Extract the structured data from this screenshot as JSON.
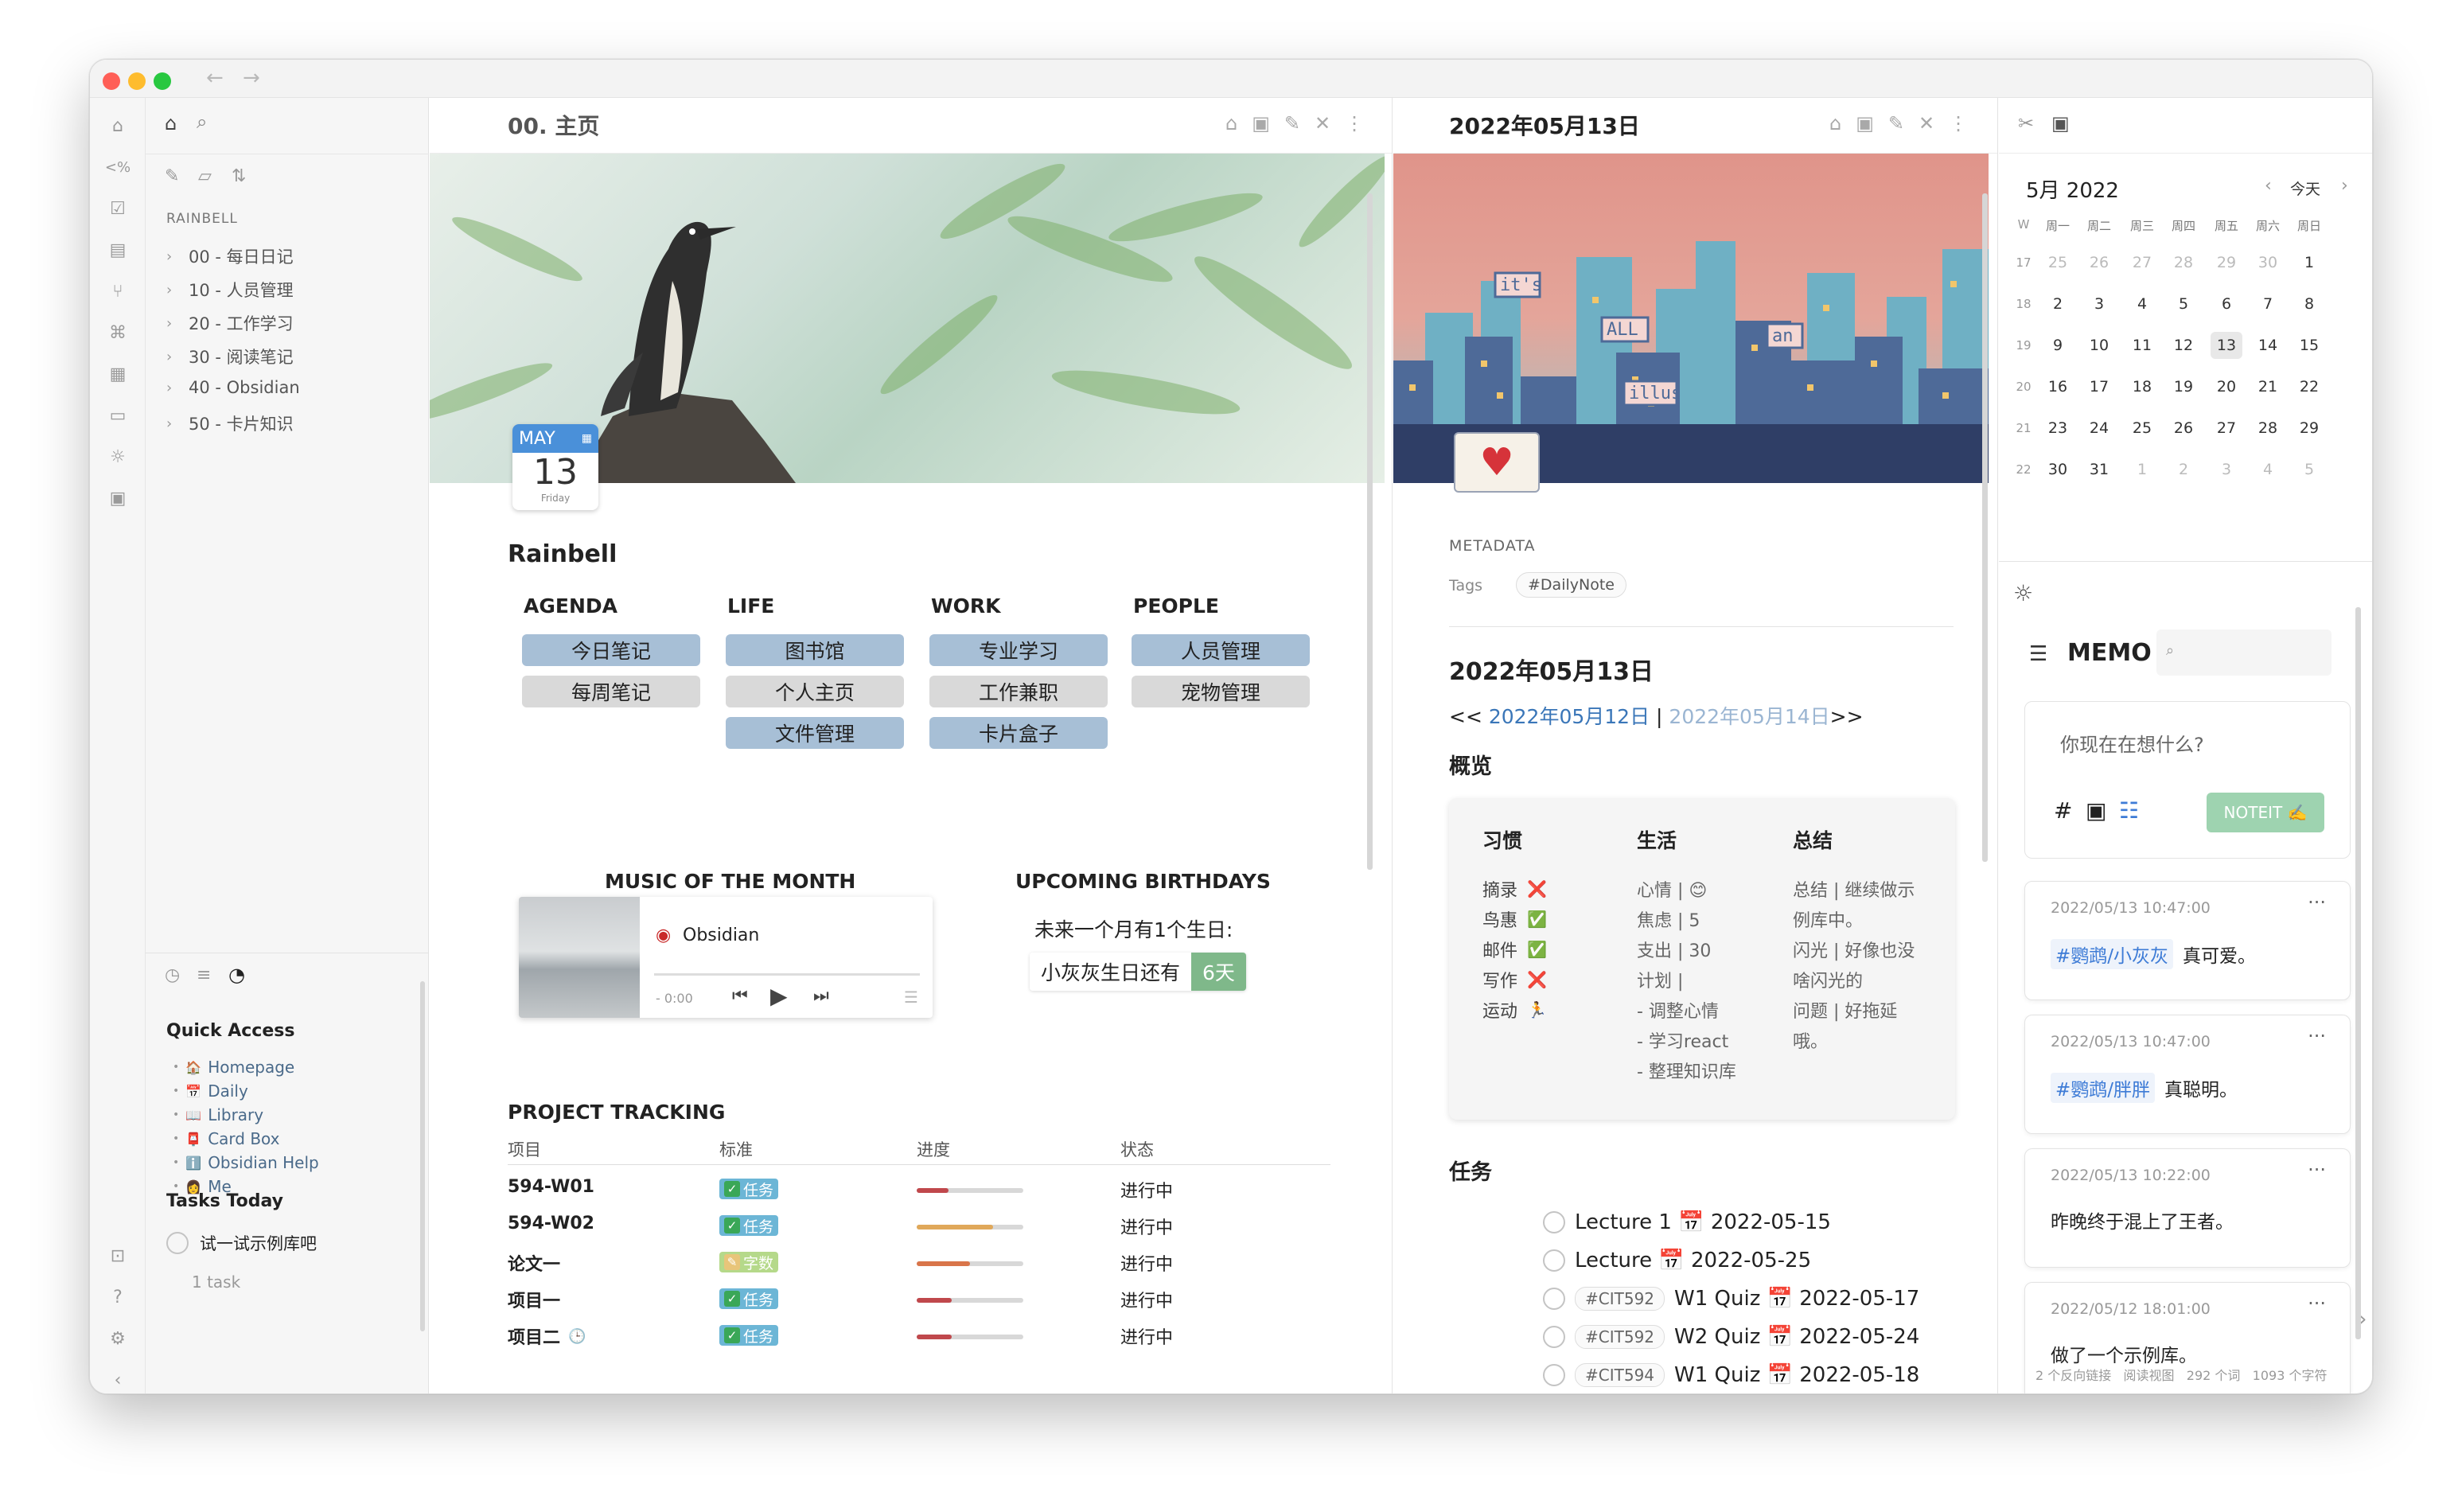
{
  "window": {
    "traffic_lights": [
      "#ff5f57",
      "#febc2e",
      "#28c840"
    ],
    "nav_back": "←",
    "nav_forward": "→"
  },
  "left_sidebar": {
    "vault_name": "RAINBELL",
    "tree": [
      {
        "label": "00 - 每日日记"
      },
      {
        "label": "10 - 人员管理"
      },
      {
        "label": "20 - 工作学习"
      },
      {
        "label": "30 - 阅读笔记"
      },
      {
        "label": "40 - Obsidian"
      },
      {
        "label": "50 - 卡片知识"
      }
    ],
    "quick_access": {
      "title": "Quick Access",
      "items": [
        {
          "icon": "🏠",
          "label": "Homepage"
        },
        {
          "icon": "📅",
          "label": "Daily"
        },
        {
          "icon": "📖",
          "label": "Library"
        },
        {
          "icon": "📮",
          "label": "Card Box"
        },
        {
          "icon": "ℹ️",
          "label": "Obsidian Help"
        },
        {
          "icon": "👩",
          "label": "Me"
        }
      ]
    },
    "tasks_today": {
      "title": "Tasks Today",
      "task": "试一试示例库吧",
      "count": "1 task"
    }
  },
  "home_pane": {
    "title": "00. 主页",
    "date_badge": {
      "month": "MAY",
      "day": "13",
      "weekday": "Friday"
    },
    "heading": "Rainbell",
    "columns": [
      {
        "title": "AGENDA",
        "buttons": [
          {
            "label": "今日笔记",
            "style": "blue"
          },
          {
            "label": "每周笔记",
            "style": "grey"
          }
        ]
      },
      {
        "title": "LIFE",
        "buttons": [
          {
            "label": "图书馆",
            "style": "blue"
          },
          {
            "label": "个人主页",
            "style": "grey"
          },
          {
            "label": "文件管理",
            "style": "blue"
          }
        ]
      },
      {
        "title": "WORK",
        "buttons": [
          {
            "label": "专业学习",
            "style": "blue"
          },
          {
            "label": "工作兼职",
            "style": "grey"
          },
          {
            "label": "卡片盒子",
            "style": "blue"
          }
        ]
      },
      {
        "title": "PEOPLE",
        "buttons": [
          {
            "label": "人员管理",
            "style": "blue"
          },
          {
            "label": "宠物管理",
            "style": "grey"
          }
        ]
      }
    ],
    "music": {
      "title": "MUSIC OF THE MONTH",
      "track": "Obsidian",
      "time": "- 0:00"
    },
    "birthdays": {
      "title": "UPCOMING BIRTHDAYS",
      "summary": "未来一个月有1个生日:",
      "item": "小灰灰生日还有",
      "days": "6天"
    },
    "project_tracking": {
      "title": "PROJECT TRACKING",
      "headers": [
        "项目",
        "标准",
        "进度",
        "状态"
      ],
      "rows": [
        {
          "name": "594-W01",
          "standard": "任务",
          "standard_kind": "task",
          "progress": 0.3,
          "progress_color": "#c0484c",
          "status": "进行中"
        },
        {
          "name": "594-W02",
          "standard": "任务",
          "standard_kind": "task",
          "progress": 0.72,
          "progress_color": "#e0a85a",
          "status": "进行中"
        },
        {
          "name": "论文一",
          "standard": "字数",
          "standard_kind": "words",
          "progress": 0.5,
          "progress_color": "#d9754a",
          "status": "进行中"
        },
        {
          "name": "项目一",
          "standard": "任务",
          "standard_kind": "task",
          "progress": 0.33,
          "progress_color": "#c0484c",
          "status": "进行中"
        },
        {
          "name": "项目二",
          "standard": "任务",
          "standard_kind": "task",
          "progress": 0.33,
          "progress_color": "#c0484c",
          "status": "进行中",
          "suffix_icon": "🕒"
        }
      ]
    }
  },
  "daily_pane": {
    "title": "2022年05月13日",
    "banner_words": [
      "it's",
      "ALL",
      "an",
      "illus"
    ],
    "metadata_label": "METADATA",
    "tags_label": "Tags",
    "tag": "#DailyNote",
    "heading": "2022年05月13日",
    "nav": {
      "prev_prefix": "<< ",
      "prev": "2022年05月12日",
      "sep": " | ",
      "next": "2022年05月14日",
      "next_suffix": ">>"
    },
    "overview_title": "概览",
    "overview": {
      "habits": {
        "title": "习惯",
        "items": [
          {
            "label": "摘录",
            "mark": "❌"
          },
          {
            "label": "鸟惠",
            "mark": "✅"
          },
          {
            "label": "邮件",
            "mark": "✅"
          },
          {
            "label": "写作",
            "mark": "❌"
          },
          {
            "label": "运动",
            "mark": "🏃"
          }
        ]
      },
      "life": {
        "title": "生活",
        "lines": [
          "心情 | 😊",
          "焦虑 | 5",
          "支出 | 30",
          "计划 |",
          "- 调整心情",
          "- 学习react",
          "- 整理知识库"
        ]
      },
      "summary": {
        "title": "总结",
        "lines": [
          "总结 | 继续做示",
          "例库中。",
          "闪光 | 好像也没",
          "啥闪光的",
          "问题 | 好拖延",
          "哦。"
        ]
      }
    },
    "tasks_title": "任务",
    "tasks": [
      {
        "tag": "",
        "text": "Lecture 1 📅 2022-05-15"
      },
      {
        "tag": "",
        "text": "Lecture 📅 2022-05-25"
      },
      {
        "tag": "#CIT592",
        "text": "W1 Quiz 📅 2022-05-17"
      },
      {
        "tag": "#CIT592",
        "text": "W2 Quiz 📅 2022-05-24"
      },
      {
        "tag": "#CIT594",
        "text": "W1 Quiz 📅 2022-05-18"
      }
    ]
  },
  "calendar": {
    "month_label": "5月 2022",
    "today_label": "今天",
    "weekdays": [
      "W",
      "周一",
      "周二",
      "周三",
      "周四",
      "周五",
      "周六",
      "周日"
    ],
    "weeks": [
      {
        "w": "17",
        "days": [
          "25",
          "26",
          "27",
          "28",
          "29",
          "30",
          "1"
        ]
      },
      {
        "w": "18",
        "days": [
          "2",
          "3",
          "4",
          "5",
          "6",
          "7",
          "8"
        ]
      },
      {
        "w": "19",
        "days": [
          "9",
          "10",
          "11",
          "12",
          "13",
          "14",
          "15"
        ]
      },
      {
        "w": "20",
        "days": [
          "16",
          "17",
          "18",
          "19",
          "20",
          "21",
          "22"
        ]
      },
      {
        "w": "21",
        "days": [
          "23",
          "24",
          "25",
          "26",
          "27",
          "28",
          "29"
        ]
      },
      {
        "w": "22",
        "days": [
          "30",
          "31",
          "1",
          "2",
          "3",
          "4",
          "5"
        ]
      }
    ],
    "selected_day": "13"
  },
  "memos": {
    "title": "MEMO",
    "placeholder": "你现在在想什么?",
    "submit": "NOTEIT ✍️",
    "items": [
      {
        "time": "2022/05/13 10:47:00",
        "tag": "#鹦鹉/小灰灰",
        "text": "真可爱。"
      },
      {
        "time": "2022/05/13 10:47:00",
        "tag": "#鹦鹉/胖胖",
        "text": "真聪明。"
      },
      {
        "time": "2022/05/13 10:22:00",
        "tag": "",
        "text": "昨晚终于混上了王者。"
      },
      {
        "time": "2022/05/12 18:01:00",
        "tag": "",
        "text": "做了一个示例库。"
      }
    ],
    "more": "···"
  },
  "status_bar": {
    "text": "2 个反向链接   阅读视图   292 个词   1093 个字符"
  }
}
